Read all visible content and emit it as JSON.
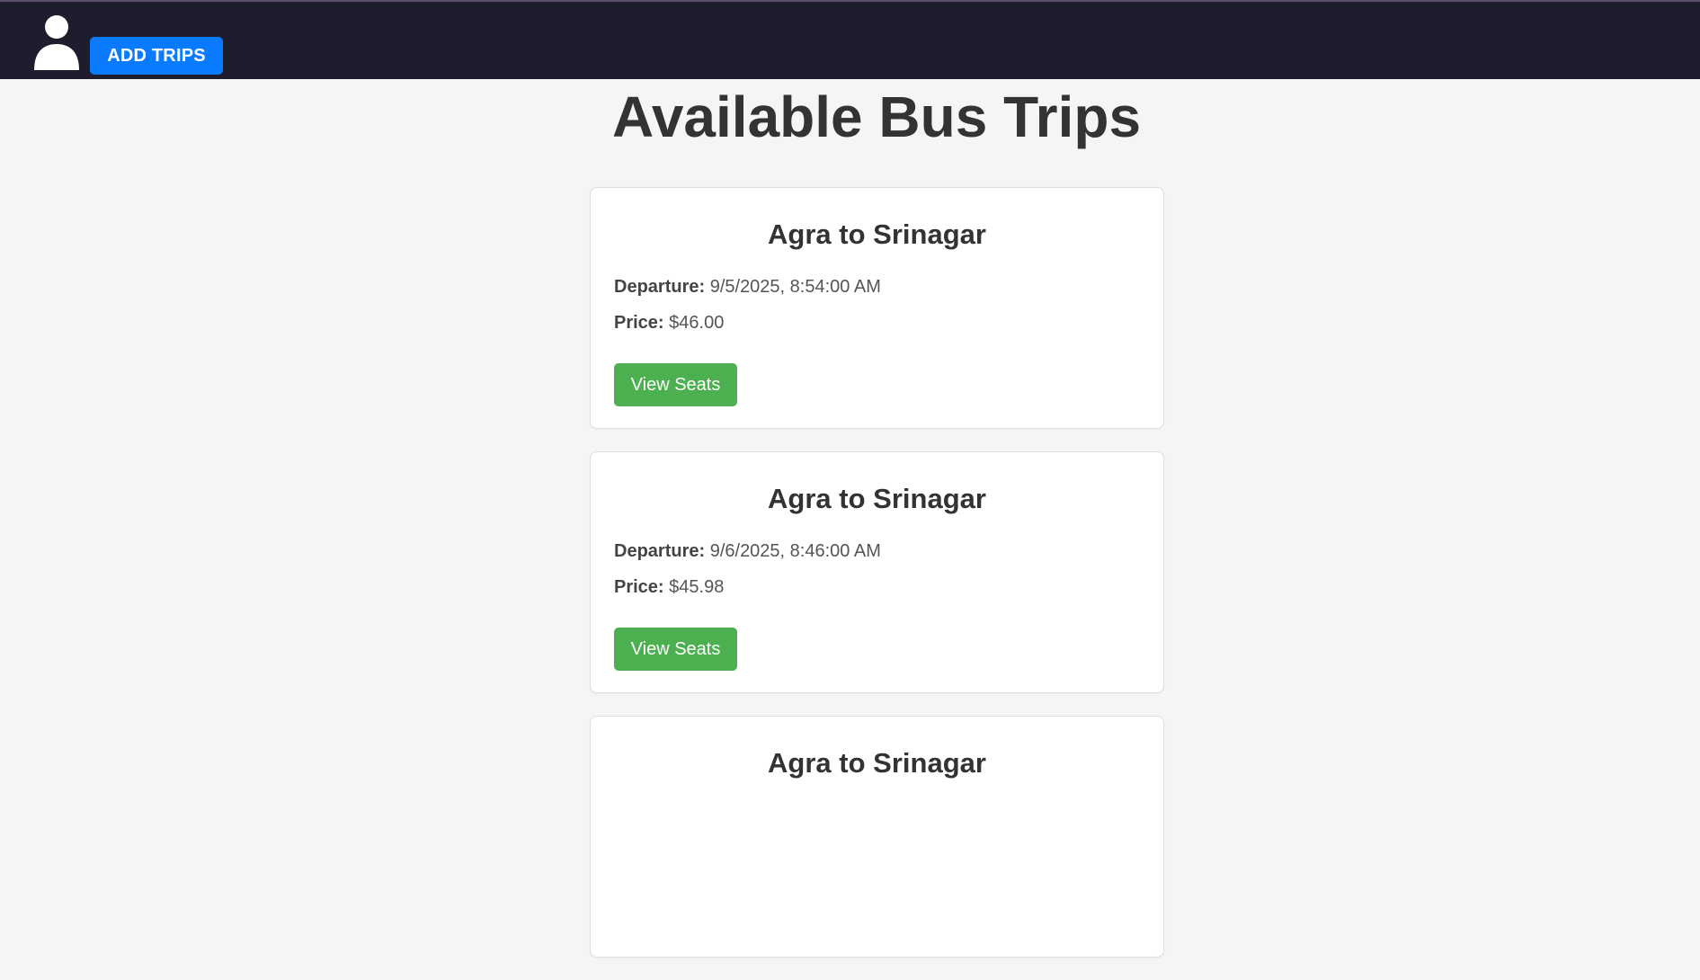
{
  "header": {
    "add_trips_label": "ADD TRIPS",
    "avatar_icon": "user-icon"
  },
  "main": {
    "title": "Available Bus Trips",
    "labels": {
      "departure": "Departure:",
      "price": "Price:"
    },
    "trips": [
      {
        "route": "Agra to Srinagar",
        "departure": "9/5/2025, 8:54:00 AM",
        "price": "$46.00",
        "button_label": "View Seats"
      },
      {
        "route": "Agra to Srinagar",
        "departure": "9/6/2025, 8:46:00 AM",
        "price": "$45.98",
        "button_label": "View Seats"
      },
      {
        "route": "Agra to Srinagar"
      }
    ]
  },
  "colors": {
    "navbar": "#1e1d2e",
    "add_trips_button": "#0a7bff",
    "view_seats_button": "#4caf50",
    "page_background": "#f4f5f5"
  }
}
